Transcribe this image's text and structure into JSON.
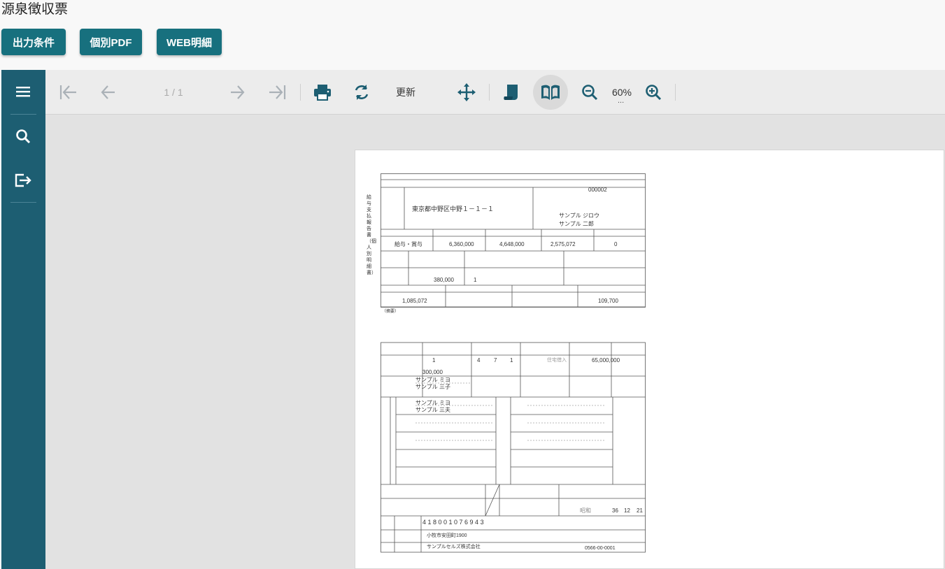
{
  "header": {
    "title": "源泉徴収票"
  },
  "actions": {
    "output_conditions": "出力条件",
    "individual_pdf": "個別PDF",
    "web_details": "WEB明細"
  },
  "sidebar": {
    "menu_icon": "menu-icon",
    "search_icon": "search-icon",
    "exit_icon": "exit-icon"
  },
  "toolbar": {
    "page_indicator": "1 / 1",
    "refresh_label": "更新",
    "zoom": "60%",
    "zoom_more": "...",
    "icons": [
      "first-page-icon",
      "prev-page-icon",
      "next-page-icon",
      "last-page-icon",
      "print-icon",
      "refresh-icon",
      "pan-icon",
      "scroll-icon",
      "book-icon",
      "zoom-out-icon",
      "zoom-in-icon"
    ]
  },
  "document": {
    "form_title": "給与支払報告書（個人別明細書）",
    "address": "東京都中野区中野１－１－１",
    "employee_no": "000002",
    "name_kana": "サンプル ジロウ",
    "name": "サンプル 二郎",
    "payment_type": "給与・賞与",
    "payment_amount": "6,360,000",
    "after_deduction": "4,648,000",
    "deduction_total": "2,575,072",
    "withholding_tax": "0",
    "spouse_deduction": "380,000",
    "dependents": "1",
    "social_insurance": "1,085,072",
    "housing_loan": "109,700",
    "note_label": "（摘要）",
    "count_1": "1",
    "count_4": "4",
    "count_7": "7",
    "count_1b": "1",
    "former_insurance": "住宅借入",
    "loan_balance": "65,000,000",
    "spouse_amount": "300,000",
    "dependent_1_kana": "サンプル ミヨ",
    "dependent_1": "サンプル 三子",
    "dependent_2_kana": "サンプル ミヨ",
    "dependent_2": "サンプル 三夫",
    "era": "昭和",
    "birth_year": "36",
    "birth_month": "12",
    "birth_day": "21",
    "payer_number": "4 1 8 0 0 1 0 7 6 9 4 3",
    "payer_address": "小牧市安田町1900",
    "payer_name": "サンプルセルズ株式会社",
    "payer_phone": "0566-00-0001"
  }
}
